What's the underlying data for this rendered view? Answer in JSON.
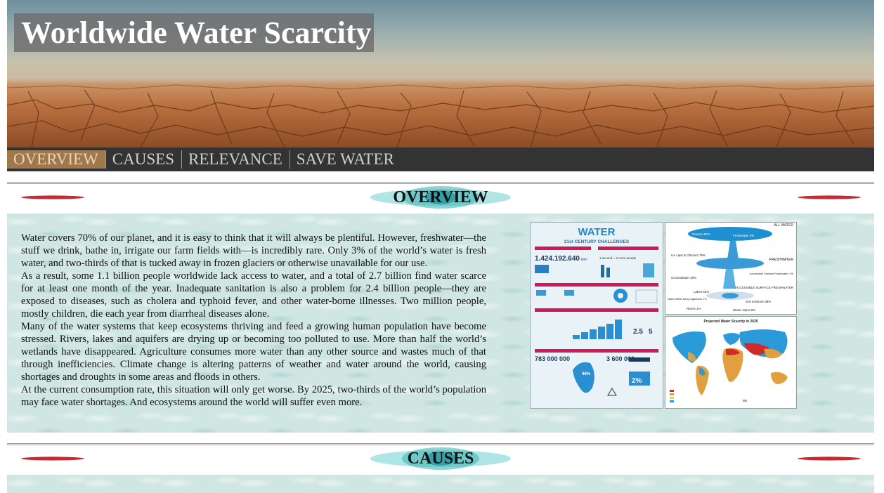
{
  "site": {
    "title": "Worldwide Water Scarcity"
  },
  "nav": {
    "items": [
      {
        "label": "OVERVIEW",
        "active": true
      },
      {
        "label": "CAUSES",
        "active": false
      },
      {
        "label": "RELEVANCE",
        "active": false
      },
      {
        "label": "SAVE WATER",
        "active": false
      }
    ]
  },
  "sections": {
    "overview": {
      "heading": "OVERVIEW",
      "paragraphs": [
        "Water covers 70% of our planet, and it is easy to think that it will always be plentiful. However, freshwater—the stuff we drink, bathe in, irrigate our farm fields with—is incredibly rare. Only 3% of the world’s water is fresh water, and two-thirds of that is tucked away in frozen glaciers or otherwise unavailable for our use.",
        "As a result, some 1.1 billion people worldwide lack access to water, and a total of 2.7 billion find water scarce for at least one month of the year. Inadequate sanitation is also a problem for 2.4 billion people—they are exposed to diseases, such as cholera and typhoid fever, and other water-borne illnesses. Two million people, mostly children, die each year from diarrheal diseases alone.",
        "Many of the water systems that keep ecosystems thriving and feed a growing human population have become stressed. Rivers, lakes and aquifers are drying up or becoming too polluted to use. More than half the world’s wetlands have disappeared. Agriculture consumes more water than any other source and wastes much of that through inefficiencies. Climate change is altering patterns of weather and water around the world, causing shortages and droughts in some areas and floods in others.",
        "At the current consumption rate, this situation will only get worse. By 2025, two-thirds of the world’s population may face water shortages. And ecosystems around the world will suffer even more."
      ]
    },
    "causes": {
      "heading": "CAUSES"
    }
  },
  "infographics": {
    "water_challenges": {
      "title": "WATER",
      "subtitle": "21st CENTURY CHALLENGES",
      "big_number": "1.424.192.640",
      "big_unit": "km³",
      "stat_people": "1 second = 2 more people",
      "stat_783": "783\n000\n000",
      "stat_3600": "3\n600\n000",
      "stat_46": "46%",
      "stat_2": "2%",
      "stat_25": "2.5",
      "stat_5": "5"
    },
    "all_water": {
      "top_label": "ALL WATER",
      "oceans": "Oceans 97%",
      "freshwater_pct": "Freshwater 3%",
      "ice": "Ice caps & Glaciers 79%",
      "freshwater": "FRESHWATER",
      "accessible": "Accessible Surface Freshwater 1%",
      "groundwater": "Groundwater 20%",
      "accessible_surface": "ACCESSIBLE SURFACE FRESHWATER",
      "lakes": "Lakes 52%",
      "organisms": "Water within living organisms 1%",
      "soil": "Soil moisture 38%",
      "rivers": "Rivers 1%",
      "vapor": "Water vapor 8%"
    },
    "map": {
      "title": "Projected Water Scarcity in 2025"
    }
  },
  "colors": {
    "nav_bg": "#333333",
    "nav_active": "#a0784a",
    "panel_bg": "#cfe6e2",
    "title_bg": "#6e6e6e"
  }
}
